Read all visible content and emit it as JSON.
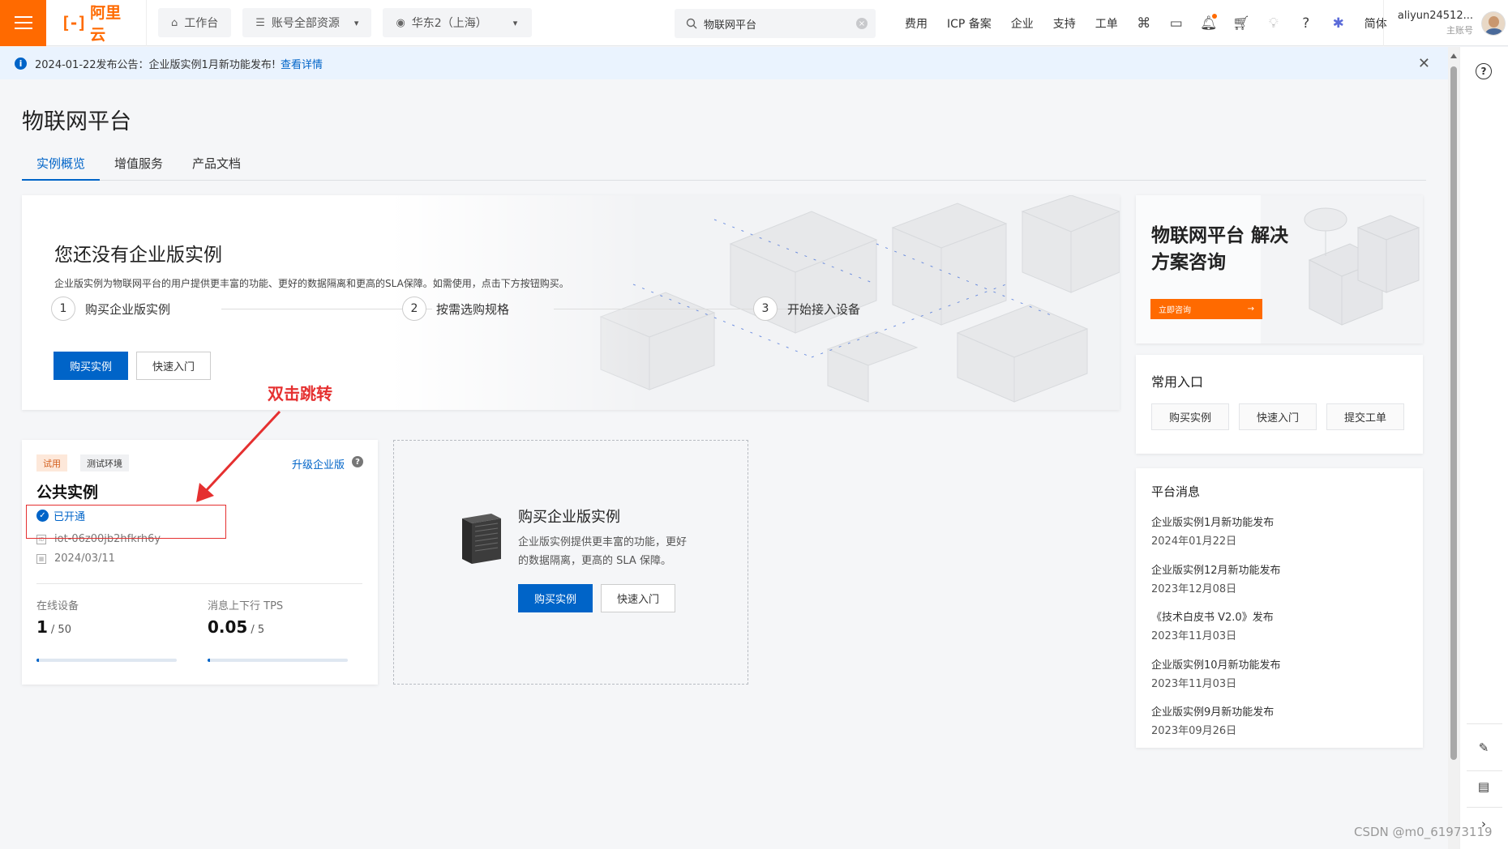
{
  "topbar": {
    "logo_mark": "[-]",
    "logo_text": "阿里云",
    "workbench": "工作台",
    "resources": "账号全部资源",
    "region": "华东2（上海）",
    "search_value": "物联网平台",
    "links": [
      "费用",
      "ICP 备案",
      "企业",
      "支持",
      "工单"
    ],
    "lang": "简体",
    "user_name": "aliyun24512...",
    "user_role": "主账号"
  },
  "notice": {
    "text": "2024-01-22发布公告：企业版实例1月新功能发布!",
    "link": "查看详情"
  },
  "page": {
    "title": "物联网平台",
    "tabs": [
      "实例概览",
      "增值服务",
      "产品文档"
    ]
  },
  "banner": {
    "title": "您还没有企业版实例",
    "desc": "企业版实例为物联网平台的用户提供更丰富的功能、更好的数据隔离和更高的SLA保障。如需使用，点击下方按钮购买。",
    "steps": [
      {
        "num": "1",
        "label": "购买企业版实例"
      },
      {
        "num": "2",
        "label": "按需选购规格"
      },
      {
        "num": "3",
        "label": "开始接入设备"
      }
    ],
    "buy": "购买实例",
    "quick": "快速入门"
  },
  "promo": {
    "title": "物联网平台 解决方案咨询",
    "btn": "立即咨询"
  },
  "common": {
    "title": "常用入口",
    "items": [
      "购买实例",
      "快速入门",
      "提交工单"
    ]
  },
  "messages": {
    "title": "平台消息",
    "items": [
      {
        "title": "企业版实例1月新功能发布",
        "date": "2024年01月22日"
      },
      {
        "title": "企业版实例12月新功能发布",
        "date": "2023年12月08日"
      },
      {
        "title": "《技术白皮书 V2.0》发布",
        "date": "2023年11月03日"
      },
      {
        "title": "企业版实例10月新功能发布",
        "date": "2023年11月03日"
      },
      {
        "title": "企业版实例9月新功能发布",
        "date": "2023年09月26日"
      }
    ]
  },
  "instance": {
    "tag_trial": "试用",
    "tag_env": "测试环境",
    "upgrade": "升级企业版",
    "name": "公共实例",
    "status": "已开通",
    "id": "iot-06z00jb2hfkrh6y",
    "date": "2024/03/11",
    "devices_label": "在线设备",
    "devices_value": "1",
    "devices_total": "/ 50",
    "devices_fraction": 0.02,
    "tps_label": "消息上下行 TPS",
    "tps_value": "0.05",
    "tps_total": "/ 5",
    "tps_fraction": 0.01
  },
  "buy_card": {
    "title": "购买企业版实例",
    "desc": "企业版实例提供更丰富的功能，更好的数据隔离，更高的 SLA 保障。",
    "buy": "购买实例",
    "quick": "快速入门"
  },
  "annotation": {
    "text": "双击跳转"
  },
  "watermark": "CSDN @m0_61973119",
  "colors": {
    "brand": "#ff6a00",
    "primary": "#0064c8",
    "annotation": "#e53030"
  }
}
